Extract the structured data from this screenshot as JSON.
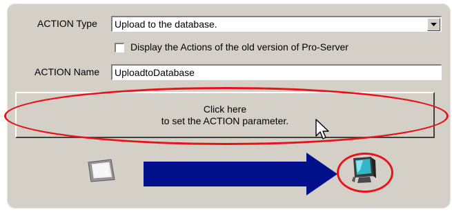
{
  "action_type": {
    "label": "ACTION Type",
    "value": "Upload to the database."
  },
  "old_version_checkbox": {
    "label": "Display the Actions of the old version of Pro-Server",
    "checked": false
  },
  "action_name": {
    "label": "ACTION Name",
    "value": "UploadtoDatabase"
  },
  "parameter_button": {
    "line1": "Click here",
    "line2": "to set the ACTION parameter."
  },
  "flow": {
    "source_icon": "display-panel-icon",
    "arrow_icon": "right-arrow-icon",
    "target_icon": "pc-monitor-icon"
  },
  "colors": {
    "highlight": "#e8121a",
    "arrow": "#00108a",
    "panel": "#d4d0c8"
  }
}
